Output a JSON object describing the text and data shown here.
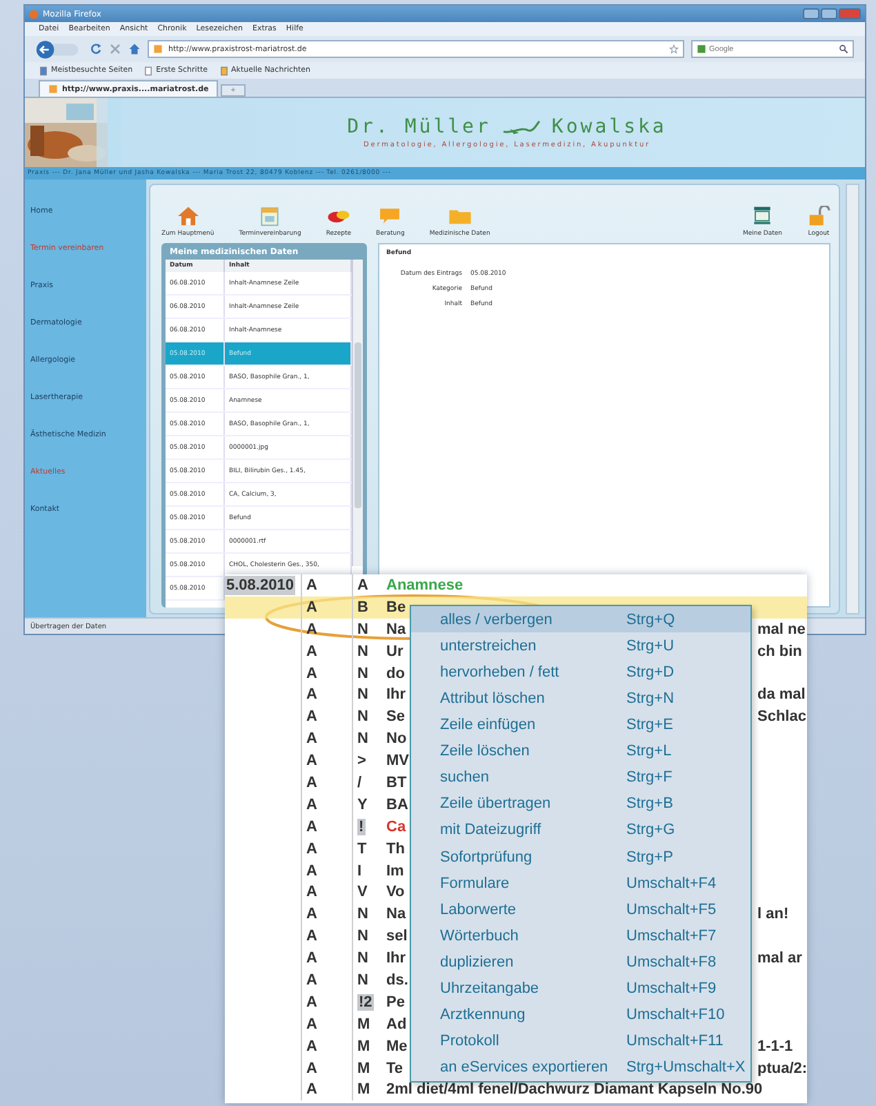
{
  "browser": {
    "title": "Mozilla Firefox",
    "menu": [
      "Datei",
      "Bearbeiten",
      "Ansicht",
      "Chronik",
      "Lesezeichen",
      "Extras",
      "Hilfe"
    ],
    "url": "http://www.praxistrost-mariatrost.de",
    "search_placeholder": "Google",
    "bookmarks": [
      "Meistbesuchte Seiten",
      "Erste Schritte",
      "Aktuelle Nachrichten"
    ],
    "tabs": [
      {
        "label": "http://www.praxis....mariatrost.de",
        "selected": true
      }
    ],
    "new_tab": "+",
    "status": "Übertragen der Daten"
  },
  "site": {
    "title_left": "Dr. Müller",
    "title_right": "Kowalska",
    "subtitle": "Dermatologie, Allergologie, Lasermedizin, Akupunktur",
    "address": "Praxis --- Dr. Jana Müller und Jasha Kowalska --- Maria Trost 22, 80479 Koblenz --- Tel. 0261/8000 ---"
  },
  "sidebar": [
    {
      "label": "Home",
      "highlighted": false
    },
    {
      "label": "Termin vereinbaren",
      "highlighted": true
    },
    {
      "label": "Praxis",
      "highlighted": false
    },
    {
      "label": "Dermatologie",
      "highlighted": false
    },
    {
      "label": "Allergologie",
      "highlighted": false
    },
    {
      "label": "Lasertherapie",
      "highlighted": false
    },
    {
      "label": "Ästhetische Medizin",
      "highlighted": false
    },
    {
      "label": "Aktuelles",
      "highlighted": true
    },
    {
      "label": "Kontakt",
      "highlighted": false
    }
  ],
  "toolbar": {
    "main": [
      {
        "label": "Zum Hauptmenü",
        "kind": "home"
      },
      {
        "label": "Terminvereinbarung",
        "kind": "calendar"
      },
      {
        "label": "Rezepte",
        "kind": "pills"
      },
      {
        "label": "Beratung",
        "kind": "chat"
      },
      {
        "label": "Medizinische Daten",
        "kind": "folder"
      }
    ],
    "account": [
      {
        "label": "Meine Daten",
        "kind": "monitor"
      },
      {
        "label": "Logout",
        "kind": "lock"
      }
    ]
  },
  "records": {
    "title": "Meine medizinischen Daten",
    "columns": [
      "Datum",
      "Inhalt"
    ],
    "rows": [
      {
        "date": "06.08.2010",
        "content": "Inhalt-Anamnese Zeile",
        "selected": false
      },
      {
        "date": "06.08.2010",
        "content": "Inhalt-Anamnese Zeile",
        "selected": false
      },
      {
        "date": "06.08.2010",
        "content": "Inhalt-Anamnese",
        "selected": false
      },
      {
        "date": "05.08.2010",
        "content": "Befund",
        "selected": true
      },
      {
        "date": "05.08.2010",
        "content": "BASO, Basophile Gran., 1,",
        "selected": false
      },
      {
        "date": "05.08.2010",
        "content": "Anamnese",
        "selected": false
      },
      {
        "date": "05.08.2010",
        "content": "BASO, Basophile Gran., 1,",
        "selected": false
      },
      {
        "date": "05.08.2010",
        "content": "0000001.jpg",
        "selected": false
      },
      {
        "date": "05.08.2010",
        "content": "BILI, Bilirubin Ges., 1.45,",
        "selected": false
      },
      {
        "date": "05.08.2010",
        "content": "CA, Calcium, 3,",
        "selected": false
      },
      {
        "date": "05.08.2010",
        "content": "Befund",
        "selected": false
      },
      {
        "date": "05.08.2010",
        "content": "0000001.rtf",
        "selected": false
      },
      {
        "date": "05.08.2010",
        "content": "CHOL, Cholesterin Ges., 350,",
        "selected": false
      },
      {
        "date": "05.08.2010",
        "selected": false
      }
    ]
  },
  "detail": {
    "title": "Befund",
    "fields": [
      {
        "label": "Datum des Eintrags",
        "value": "05.08.2010"
      },
      {
        "label": "Kategorie",
        "value": "Befund"
      },
      {
        "label": "Inhalt",
        "value": "Befund"
      }
    ]
  },
  "editor": {
    "rows": [
      {
        "date": "5.08.2010",
        "code1": "A",
        "code2": "A",
        "text": "Anamnese",
        "color": "#3aa84a",
        "marked": false,
        "selected": false
      },
      {
        "code1": "A",
        "code2": "B",
        "text": "Be",
        "marked": false,
        "selected": true
      },
      {
        "code1": "A",
        "code2": "N",
        "text": "Na",
        "right": "mal ne",
        "marked": false,
        "selected": false
      },
      {
        "code1": "A",
        "code2": "N",
        "text": "Ur",
        "right": "ch bin",
        "marked": false,
        "selected": false
      },
      {
        "code1": "A",
        "code2": "N",
        "text": "do",
        "marked": false,
        "selected": false
      },
      {
        "code1": "A",
        "code2": "N",
        "text": "Ihr",
        "right": "da mal",
        "marked": false,
        "selected": false
      },
      {
        "code1": "A",
        "code2": "N",
        "text": "Se",
        "right": "Schlac",
        "marked": false,
        "selected": false
      },
      {
        "code1": "A",
        "code2": "N",
        "text": "No",
        "marked": false,
        "selected": false
      },
      {
        "code1": "A",
        "code2": ">",
        "text": "MV",
        "marked": false,
        "selected": false
      },
      {
        "code1": "A",
        "code2": "/",
        "text": "BT",
        "marked": false,
        "selected": false
      },
      {
        "code1": "A",
        "code2": "Y",
        "text": "BA",
        "marked": false,
        "selected": false
      },
      {
        "code1": "A",
        "code2": "!",
        "text": "Ca",
        "color": "#d8342c",
        "marked": true,
        "selected": false
      },
      {
        "code1": "A",
        "code2": "T",
        "text": "Th",
        "marked": false,
        "selected": false
      },
      {
        "code1": "A",
        "code2": "I",
        "text": "Im",
        "marked": false,
        "selected": false
      },
      {
        "code1": "A",
        "code2": "V",
        "text": "Vo",
        "marked": false,
        "selected": false
      },
      {
        "code1": "A",
        "code2": "N",
        "text": "Na",
        "right": "l an!",
        "marked": false,
        "selected": false
      },
      {
        "code1": "A",
        "code2": "N",
        "text": "sel",
        "marked": false,
        "selected": false
      },
      {
        "code1": "A",
        "code2": "N",
        "text": "Ihr",
        "right": "mal ar",
        "marked": false,
        "selected": false
      },
      {
        "code1": "A",
        "code2": "N",
        "text": "ds.",
        "marked": false,
        "selected": false
      },
      {
        "code1": "A",
        "code2": "!2",
        "text": "Pe",
        "marked": true,
        "selected": false
      },
      {
        "code1": "A",
        "code2": "M",
        "text": "Ad",
        "marked": false,
        "selected": false
      },
      {
        "code1": "A",
        "code2": "M",
        "text": "Me",
        "right": "1-1-1",
        "marked": false,
        "selected": false
      },
      {
        "code1": "A",
        "code2": "M",
        "text": "Te",
        "right": "ptua/2:",
        "marked": false,
        "selected": false
      },
      {
        "code1": "A",
        "code2": "M",
        "text": "2ml diet/4ml fenel/Dachwurz Diamant Kapseln No.90",
        "marked": false,
        "selected": false
      }
    ]
  },
  "context_menu": {
    "items": [
      {
        "label": "alles / verbergen",
        "shortcut": "Strg+Q",
        "selected": true
      },
      {
        "label": "unterstreichen",
        "shortcut": "Strg+U",
        "selected": false
      },
      {
        "label": "hervorheben / fett",
        "shortcut": "Strg+D",
        "selected": false
      },
      {
        "label": "Attribut löschen",
        "shortcut": "Strg+N",
        "selected": false
      },
      {
        "label": "Zeile einfügen",
        "shortcut": "Strg+E",
        "selected": false
      },
      {
        "label": "Zeile löschen",
        "shortcut": "Strg+L",
        "selected": false
      },
      {
        "label": "suchen",
        "shortcut": "Strg+F",
        "selected": false
      },
      {
        "label": "Zeile übertragen",
        "shortcut": "Strg+B",
        "selected": false
      },
      {
        "label": "mit Dateizugriff",
        "shortcut": "Strg+G",
        "selected": false
      },
      {
        "label": "Sofortprüfung",
        "shortcut": "Strg+P",
        "selected": false
      },
      {
        "label": "Formulare",
        "shortcut": "Umschalt+F4",
        "selected": false
      },
      {
        "label": "Laborwerte",
        "shortcut": "Umschalt+F5",
        "selected": false
      },
      {
        "label": "Wörterbuch",
        "shortcut": "Umschalt+F7",
        "selected": false
      },
      {
        "label": "duplizieren",
        "shortcut": "Umschalt+F8",
        "selected": false
      },
      {
        "label": "Uhrzeitangabe",
        "shortcut": "Umschalt+F9",
        "selected": false
      },
      {
        "label": "Arztkennung",
        "shortcut": "Umschalt+F10",
        "selected": false
      },
      {
        "label": "Protokoll",
        "shortcut": "Umschalt+F11",
        "selected": false
      },
      {
        "label": "an eServices exportieren",
        "shortcut": "Strg+Umschalt+X",
        "selected": false
      }
    ]
  }
}
